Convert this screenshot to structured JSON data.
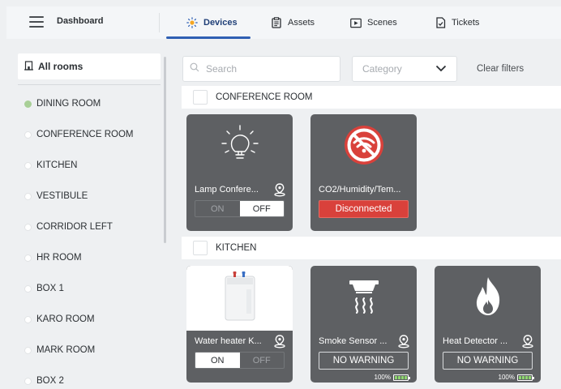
{
  "header": {
    "title": "Dashboard",
    "tabs": [
      {
        "label": "Devices",
        "icon": "lightbulb-icon",
        "active": true
      },
      {
        "label": "Assets",
        "icon": "clipboard-icon"
      },
      {
        "label": "Scenes",
        "icon": "play-icon"
      },
      {
        "label": "Tickets",
        "icon": "ticket-check-icon"
      }
    ]
  },
  "sidebar": {
    "all_rooms": "All rooms",
    "rooms": [
      {
        "label": "DINING ROOM",
        "active": true
      },
      {
        "label": "CONFERENCE ROOM"
      },
      {
        "label": "KITCHEN"
      },
      {
        "label": "VESTIBULE"
      },
      {
        "label": "CORRIDOR LEFT"
      },
      {
        "label": "HR ROOM"
      },
      {
        "label": "BOX 1"
      },
      {
        "label": "KARO ROOM"
      },
      {
        "label": "MARK ROOM"
      },
      {
        "label": "BOX 2"
      }
    ]
  },
  "filters": {
    "search_placeholder": "Search",
    "category_placeholder": "Category",
    "clear_label": "Clear filters"
  },
  "groups": [
    {
      "title": "CONFERENCE ROOM",
      "devices": [
        {
          "name": "Lamp Confere...",
          "icon": "lightbulb-icon",
          "on_label": "ON",
          "off_label": "OFF",
          "state": "off"
        },
        {
          "name": "CO2/Humidity/Tem...",
          "icon": "wifi-off-icon",
          "status": "Disconnected"
        }
      ]
    },
    {
      "title": "KITCHEN",
      "devices": [
        {
          "name": "Water heater K...",
          "icon": "water-heater-image",
          "on_label": "ON",
          "off_label": "OFF",
          "state": "on"
        },
        {
          "name": "Smoke Sensor ...",
          "icon": "smoke-detector-icon",
          "status": "NO WARNING",
          "battery": "100%"
        },
        {
          "name": "Heat Detector ...",
          "icon": "flame-icon",
          "status": "NO WARNING",
          "battery": "100%"
        }
      ]
    }
  ],
  "colors": {
    "accent": "#2f5fb3",
    "card": "#5e6063",
    "disconnected": "#d9413b",
    "active_room_dot": "#a8cf97",
    "battery_fill": "#8fd66f"
  }
}
